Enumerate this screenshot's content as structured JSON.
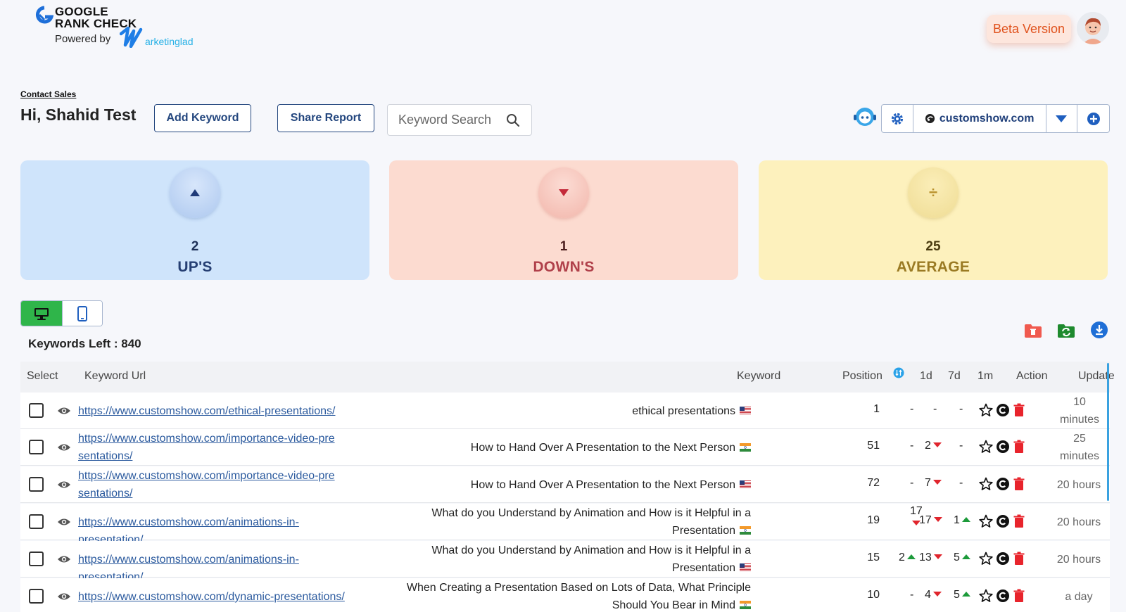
{
  "header": {
    "logo_line1": "GOOGLE",
    "logo_line2": "RANK CHECK",
    "powered_by": "Powered by",
    "brand_name": "arketinglad",
    "beta_label": "Beta Version"
  },
  "toolbar": {
    "contact_sales": "Contact Sales",
    "greeting": "Hi, Shahid Test",
    "add_keyword": "Add Keyword",
    "share_report": "Share Report",
    "search_placeholder": "Keyword Search",
    "domain": "customshow.com"
  },
  "stats": {
    "ups": {
      "value": "2",
      "label": "UP'S"
    },
    "downs": {
      "value": "1",
      "label": "DOWN'S"
    },
    "average": {
      "value": "25",
      "label": "AVERAGE",
      "symbol": "÷"
    }
  },
  "keywords_left": "Keywords Left : 840",
  "table": {
    "headers": {
      "select": "Select",
      "url": "Keyword Url",
      "keyword": "Keyword",
      "position": "Position",
      "d1": "1d",
      "d7": "7d",
      "m1": "1m",
      "action": "Action",
      "update": "Update"
    },
    "rows": [
      {
        "url": "https://www.customshow.com/ethical-presentations/",
        "keyword": "ethical presentations",
        "flag": "us",
        "position": "1",
        "d1": "-",
        "d1_dir": "",
        "d7": "-",
        "d7_dir": "",
        "m1": "-",
        "m1_dir": "",
        "update": "10 minutes"
      },
      {
        "url": "https://www.customshow.com/importance-video-presentations/",
        "keyword": "How to Hand Over A Presentation to the Next Person",
        "flag": "in",
        "position": "51",
        "d1": "-",
        "d1_dir": "",
        "d7": "2",
        "d7_dir": "down",
        "m1": "-",
        "m1_dir": "",
        "update": "25 minutes"
      },
      {
        "url": "https://www.customshow.com/importance-video-presentations/",
        "keyword": "How to Hand Over A Presentation to the Next Person",
        "flag": "us",
        "position": "72",
        "d1": "-",
        "d1_dir": "",
        "d7": "7",
        "d7_dir": "down",
        "m1": "-",
        "m1_dir": "",
        "update": "20 hours"
      },
      {
        "url": "https://www.customshow.com/animations-in-presentation/",
        "keyword": "What do you Understand by Animation and How is it Helpful in a Presentation",
        "flag": "in",
        "position": "19",
        "d1": "17",
        "d1_dir": "down",
        "d7": "17",
        "d7_dir": "down",
        "m1": "1",
        "m1_dir": "up",
        "update": "20 hours"
      },
      {
        "url": "https://www.customshow.com/animations-in-presentation/",
        "keyword": "What do you Understand by Animation and How is it Helpful in a Presentation",
        "flag": "us",
        "position": "15",
        "d1": "2",
        "d1_dir": "up",
        "d7": "13",
        "d7_dir": "down",
        "m1": "5",
        "m1_dir": "up",
        "update": "20 hours"
      },
      {
        "url": "https://www.customshow.com/dynamic-presentations/",
        "keyword": "When Creating a Presentation Based on Lots of Data, What Principle Should You Bear in Mind",
        "flag": "in",
        "position": "10",
        "d1": "-",
        "d1_dir": "",
        "d7": "4",
        "d7_dir": "down",
        "m1": "5",
        "m1_dir": "up",
        "update": "a day"
      }
    ]
  },
  "colors": {
    "accent_navy": "#23467e",
    "desktop_active": "#2fb54a",
    "beta_text": "#e0521d",
    "down": "#e0252d",
    "up": "#1c9a3a",
    "link": "#2b5a9e"
  }
}
